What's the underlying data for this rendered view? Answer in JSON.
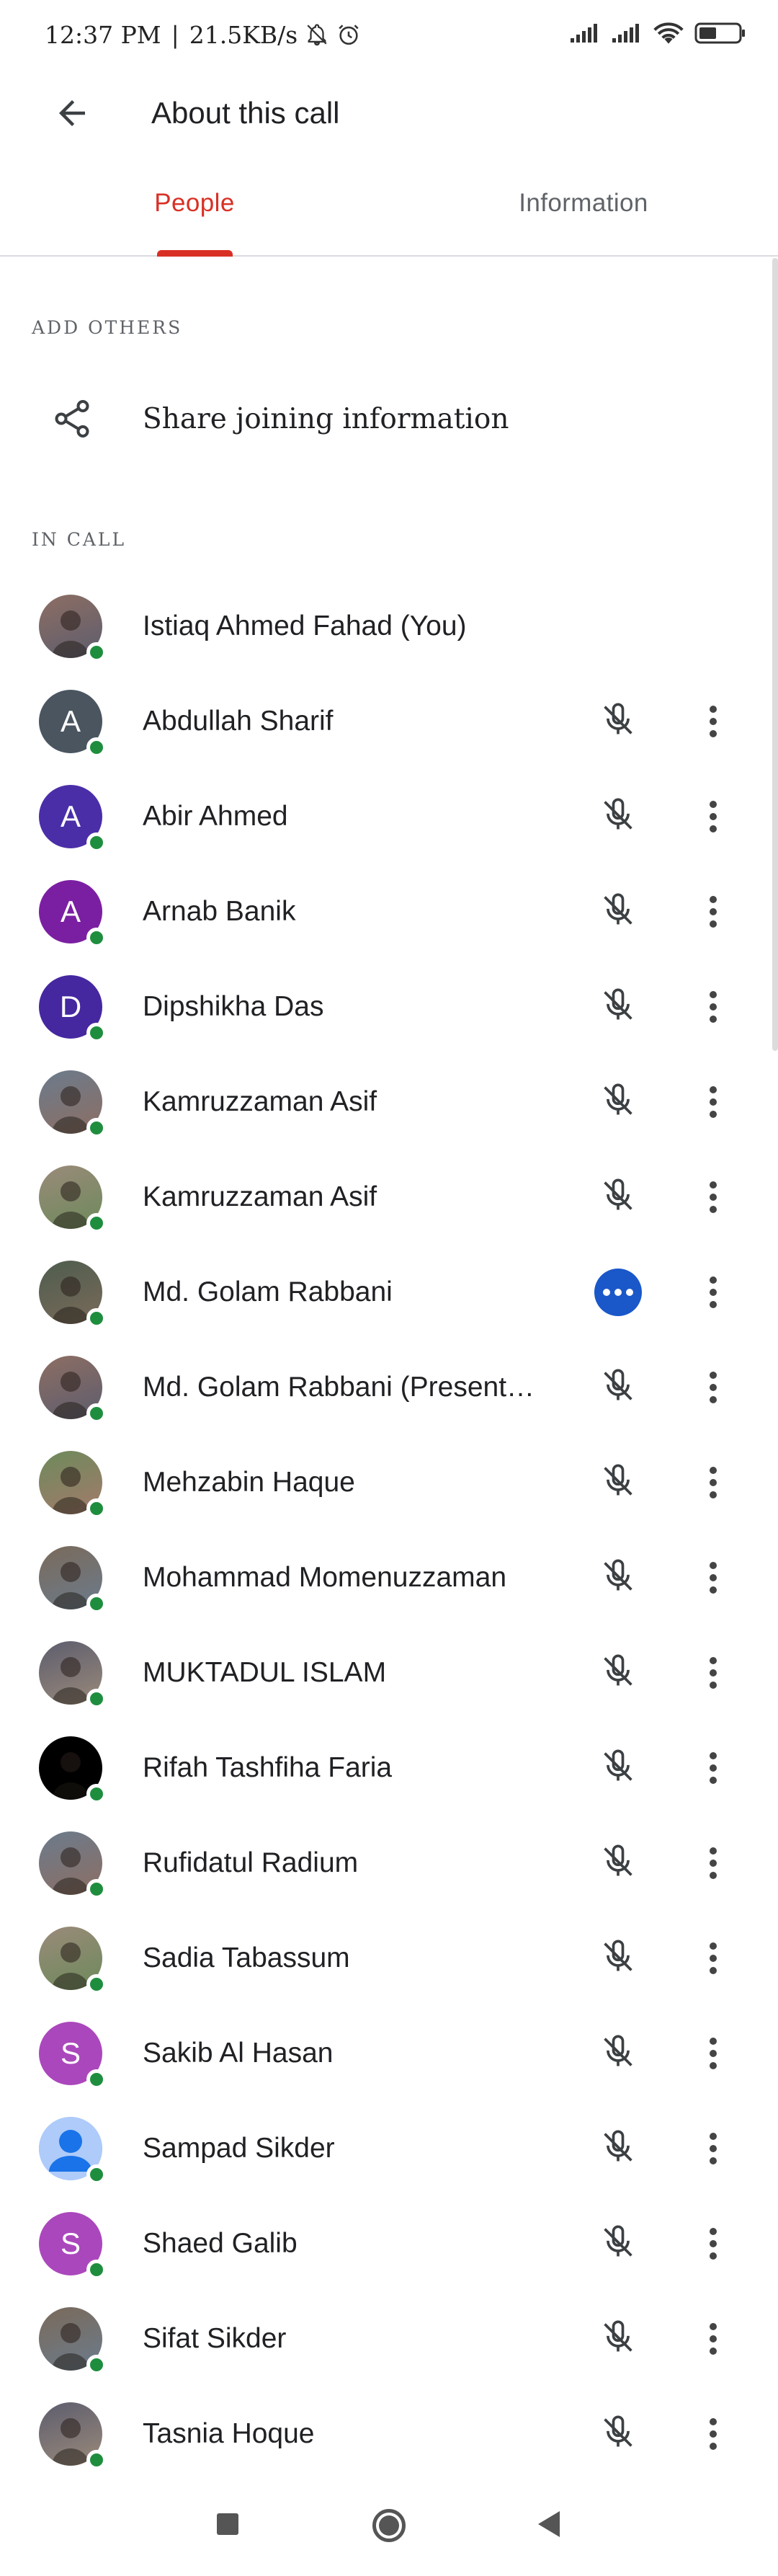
{
  "status_bar": {
    "time": "12:37 PM",
    "separator": "|",
    "network_speed": "21.5KB/s",
    "icons": [
      "silent-icon",
      "alarm-icon",
      "signal-icon",
      "signal-icon",
      "wifi-icon",
      "battery-icon"
    ],
    "battery_level": 0.45
  },
  "app_bar": {
    "title": "About this call",
    "back_icon": "arrow-back-icon"
  },
  "tabs": [
    {
      "label": "People",
      "active": true
    },
    {
      "label": "Information",
      "active": false
    }
  ],
  "colors": {
    "accent": "#d93025",
    "presence": "#1e8e3e",
    "speaking": "#1a57c9",
    "text": "#202124",
    "secondary_text": "#5f6368"
  },
  "sections": {
    "add_others": "ADD OTHERS",
    "in_call": "IN CALL"
  },
  "share": {
    "label": "Share joining information",
    "icon": "share-icon"
  },
  "participants": [
    {
      "name": "Istiaq Ahmed Fahad (You)",
      "avatar": "photo",
      "show_controls": false
    },
    {
      "name": "Abdullah Sharif",
      "avatar": "letter",
      "initial": "A",
      "color": "#4a5560",
      "mic": "muted"
    },
    {
      "name": "Abir Ahmed",
      "avatar": "letter",
      "initial": "A",
      "color": "#4a2ea8",
      "mic": "muted"
    },
    {
      "name": "Arnab Banik",
      "avatar": "letter",
      "initial": "A",
      "color": "#7b1fa2",
      "mic": "muted"
    },
    {
      "name": "Dipshikha Das",
      "avatar": "letter",
      "initial": "D",
      "color": "#4527a0",
      "mic": "muted"
    },
    {
      "name": "Kamruzzaman Asif",
      "avatar": "photo",
      "mic": "muted"
    },
    {
      "name": "Kamruzzaman Asif",
      "avatar": "photo",
      "mic": "muted"
    },
    {
      "name": "Md. Golam Rabbani",
      "avatar": "photo",
      "mic": "speaking"
    },
    {
      "name": "Md. Golam Rabbani (Present…",
      "avatar": "photo",
      "mic": "muted"
    },
    {
      "name": "Mehzabin Haque",
      "avatar": "photo",
      "mic": "muted"
    },
    {
      "name": "Mohammad Momenuzzaman",
      "avatar": "photo",
      "mic": "muted"
    },
    {
      "name": "MUKTADUL ISLAM",
      "avatar": "photo",
      "mic": "muted"
    },
    {
      "name": "Rifah Tashfiha Faria",
      "avatar": "photo",
      "mic": "muted"
    },
    {
      "name": "Rufidatul Radium",
      "avatar": "photo",
      "mic": "muted"
    },
    {
      "name": "Sadia Tabassum",
      "avatar": "photo",
      "mic": "muted"
    },
    {
      "name": "Sakib Al Hasan",
      "avatar": "letter",
      "initial": "S",
      "color": "#ab47bc",
      "mic": "muted"
    },
    {
      "name": "Sampad Sikder",
      "avatar": "default",
      "mic": "muted"
    },
    {
      "name": "Shaed Galib",
      "avatar": "letter",
      "initial": "S",
      "color": "#ab47bc",
      "mic": "muted"
    },
    {
      "name": "Sifat Sikder",
      "avatar": "photo",
      "mic": "muted"
    },
    {
      "name": "Tasnia Hoque",
      "avatar": "photo",
      "mic": "muted"
    }
  ],
  "nav_bar": {
    "buttons": [
      "recents-icon",
      "home-icon",
      "back-icon"
    ]
  }
}
